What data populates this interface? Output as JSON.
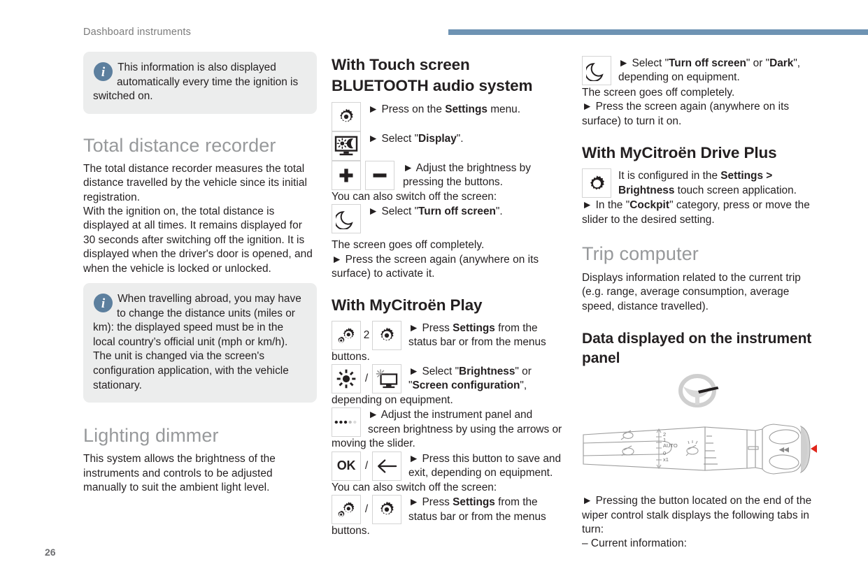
{
  "header": {
    "running_head": "Dashboard instruments",
    "rule_color": "#6e93b3"
  },
  "footer": {
    "page_number": "26"
  },
  "column_left": {
    "note_1": {
      "icon": "info-icon",
      "text": "This information is also displayed automatically every time the ignition is switched on."
    },
    "heading_total_distance": "Total distance recorder",
    "para_1": "The total distance recorder measures the total distance travelled by the vehicle since its initial registration.",
    "para_2": "With the ignition on, the total distance is displayed at all times. It remains displayed for 30 seconds after switching off the ignition. It is displayed when the driver's door is opened, and when the vehicle is locked or unlocked.",
    "note_2": {
      "icon": "info-icon",
      "text_1": "When travelling abroad, you may have to change the distance units (miles or km): the displayed speed must be in the local country’s official unit (mph or km/h).",
      "text_2": "The unit is changed via the screen's configuration application, with the vehicle stationary."
    },
    "heading_lighting_dimmer": "Lighting dimmer",
    "para_3": "This system allows the brightness of the instruments and controls to be adjusted manually to suit the ambient light level."
  },
  "column_middle": {
    "heading_touch_bluetooth": "With Touch screen BLUETOOTH audio system",
    "steps": [
      {
        "icons": [
          "gear-icon"
        ],
        "arrow": "►",
        "text_plain_1": "Press on the ",
        "text_bold": "Settings",
        "text_plain_2": " menu."
      },
      {
        "icons": [
          "display-sun-moon-icon"
        ],
        "arrow": "►",
        "text_plain_1": "Select \"",
        "text_bold": "Display",
        "text_plain_2": "\"."
      },
      {
        "icons": [
          "plus-icon",
          "minus-icon"
        ],
        "arrow": "►",
        "text_plain_1": "Adjust the brightness by pressing the buttons.",
        "text_bold": "",
        "text_plain_2": ""
      }
    ],
    "flow_1": "You can also switch off the screen:",
    "step_turn_off": {
      "icons": [
        "moon-icon"
      ],
      "arrow": "►",
      "text_plain_1": "Select \"",
      "text_bold": "Turn off screen",
      "text_plain_2": "\"."
    },
    "flow_2": "The screen goes off completely.",
    "flow_3": "►  Press the screen again (anywhere on its surface) to activate it.",
    "heading_mycitroen_play": "With MyCitroën Play",
    "play_steps": [
      {
        "icons": [
          "gears-double-icon",
          "gear-icon"
        ],
        "arrow": "►",
        "text_plain_1": "Press ",
        "text_bold": "Settings",
        "text_plain_2": " from the status bar or from the menus"
      },
      {
        "icons": [
          "brightness-sun-icon",
          "screen-brightness-icon"
        ],
        "arrow": "►",
        "text_plain_1": "Select \"",
        "text_bold": "Brightness",
        "text_plain_2": "\" or",
        "text_bold_2": "Screen configuration",
        "text_plain_3": "\","
      },
      {
        "icons": [
          "slider-dots-icon"
        ],
        "arrow": "►",
        "text_plain_1": "Adjust the instrument panel and screen brightness by using the arrows or",
        "text_bold": "",
        "text_plain_2": ""
      },
      {
        "icons": [
          "ok-button-icon",
          "back-arrow-icon"
        ],
        "arrow": "►",
        "text_plain_1": "Press this button to save and exit, depending on equipment.",
        "text_bold": "",
        "text_plain_2": ""
      },
      {
        "icons": [
          "gears-double-icon",
          "gear-icon"
        ],
        "arrow": "►",
        "text_plain_1": "Press ",
        "text_bold": "Settings",
        "text_plain_2": " from the status bar or from the menus"
      }
    ],
    "flow_buttons_1": "buttons.",
    "flow_depending": "depending on equipment.",
    "flow_moving_slider": "moving the slider.",
    "flow_switch_off": "You can also switch off the screen:",
    "flow_buttons_2": "buttons.",
    "quote_open": "\"",
    "quote_close_comma": "\","
  },
  "column_right": {
    "step_turn_off_dark": {
      "icons": [
        "moon-icon"
      ],
      "arrow": "►",
      "text_plain_1": "Select \"",
      "text_bold_1": "Turn off screen",
      "text_plain_2": "\" or \"",
      "text_bold_2": "Dark",
      "text_plain_3": "\", depending on equipment."
    },
    "flow_1": "The screen goes off completely.",
    "flow_2": "►  Press the screen again (anywhere on its surface) to turn it on.",
    "heading_drive_plus": "With MyCitroën Drive Plus",
    "drive_plus_step": {
      "icons": [
        "gear-icon"
      ],
      "text_plain_1": "It is configured in the ",
      "text_bold_1": "Settings >",
      "text_bold_2": "Brightness",
      "text_plain_2": " touch screen application."
    },
    "flow_3": "►  In the \"",
    "flow_3_bold": "Cockpit",
    "flow_3_end": "\" category, press or move the slider to the desired setting.",
    "heading_trip_computer": "Trip computer",
    "para_trip": "Displays information related to the current trip (e.g. range, average consumption, average speed, distance travelled).",
    "heading_data_displayed": "Data displayed on the instrument panel",
    "illustration": {
      "steering_wheel": "steering-wheel-icon",
      "wiper_stalk": "wiper-control-stalk-illustration",
      "arrow_color": "#e1251b",
      "stalk_labels": [
        "2",
        "1",
        "AUTO",
        "0",
        "x1"
      ]
    },
    "para_pressing": "►  Pressing the button located on the end of the wiper control stalk displays the following tabs in turn:",
    "para_current_info": "–  Current information:"
  }
}
